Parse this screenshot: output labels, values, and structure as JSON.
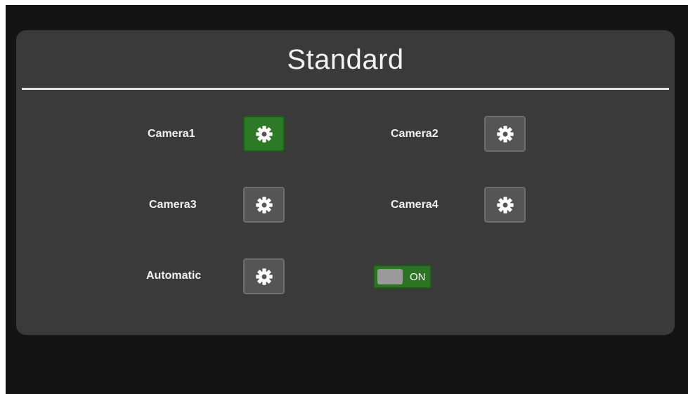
{
  "header": {
    "title": "Standard"
  },
  "cameras": [
    {
      "label": "Camera1",
      "icon": "gear-icon",
      "selected": true
    },
    {
      "label": "Camera2",
      "icon": "gear-icon",
      "selected": false
    },
    {
      "label": "Camera3",
      "icon": "gear-icon",
      "selected": false
    },
    {
      "label": "Camera4",
      "icon": "gear-icon",
      "selected": false
    }
  ],
  "automatic": {
    "label": "Automatic",
    "icon": "gear-icon",
    "toggle_state": "ON"
  },
  "colors": {
    "accent_green": "#2d7a26",
    "panel": "#3a3a3a",
    "background": "#141414",
    "button": "#555555"
  }
}
